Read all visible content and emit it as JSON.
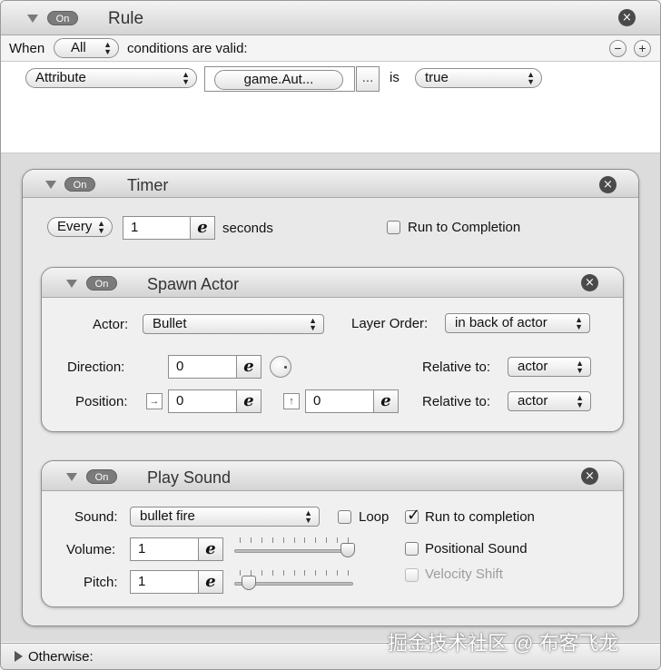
{
  "rule": {
    "toggle_label": "On",
    "title": "Rule",
    "close_glyph": "×",
    "when_label": "When",
    "when_value": "All",
    "conditions_text": "conditions are valid:",
    "minus_glyph": "−",
    "plus_glyph": "+",
    "condition": {
      "type_value": "Attribute",
      "attribute_value": "game.Aut...",
      "browse_label": "...",
      "operator_label": "is",
      "compare_value": "true"
    }
  },
  "timer": {
    "toggle_label": "On",
    "title": "Timer",
    "close_glyph": "×",
    "mode_value": "Every",
    "seconds_value": "1",
    "expression_glyph": "e",
    "seconds_label": "seconds",
    "run_to_completion_label": "Run to Completion",
    "run_to_completion_checked": false
  },
  "spawn": {
    "toggle_label": "On",
    "title": "Spawn Actor",
    "close_glyph": "×",
    "actor_label": "Actor:",
    "actor_value": "Bullet",
    "layer_label": "Layer Order:",
    "layer_value": "in back of actor",
    "direction_label": "Direction:",
    "direction_value": "0",
    "relative1_label": "Relative to:",
    "relative1_value": "actor",
    "position_label": "Position:",
    "pos_x_value": "0",
    "pos_y_value": "0",
    "relative2_label": "Relative to:",
    "relative2_value": "actor",
    "expression_glyph": "e",
    "x_glyph": "→",
    "y_glyph": "↑"
  },
  "sound": {
    "toggle_label": "On",
    "title": "Play Sound",
    "close_glyph": "×",
    "sound_label": "Sound:",
    "sound_value": "bullet fire",
    "loop_label": "Loop",
    "loop_checked": false,
    "run_label": "Run to completion",
    "run_checked": true,
    "volume_label": "Volume:",
    "volume_value": "1",
    "volume_level": 1.0,
    "positional_label": "Positional Sound",
    "positional_checked": false,
    "pitch_label": "Pitch:",
    "pitch_value": "1",
    "pitch_level": 0.08,
    "velocity_label": "Velocity Shift",
    "velocity_enabled": false,
    "expression_glyph": "e"
  },
  "otherwise": {
    "label": "Otherwise:"
  },
  "watermark": {
    "text": "掘金技术社区 @ 布客飞龙"
  }
}
